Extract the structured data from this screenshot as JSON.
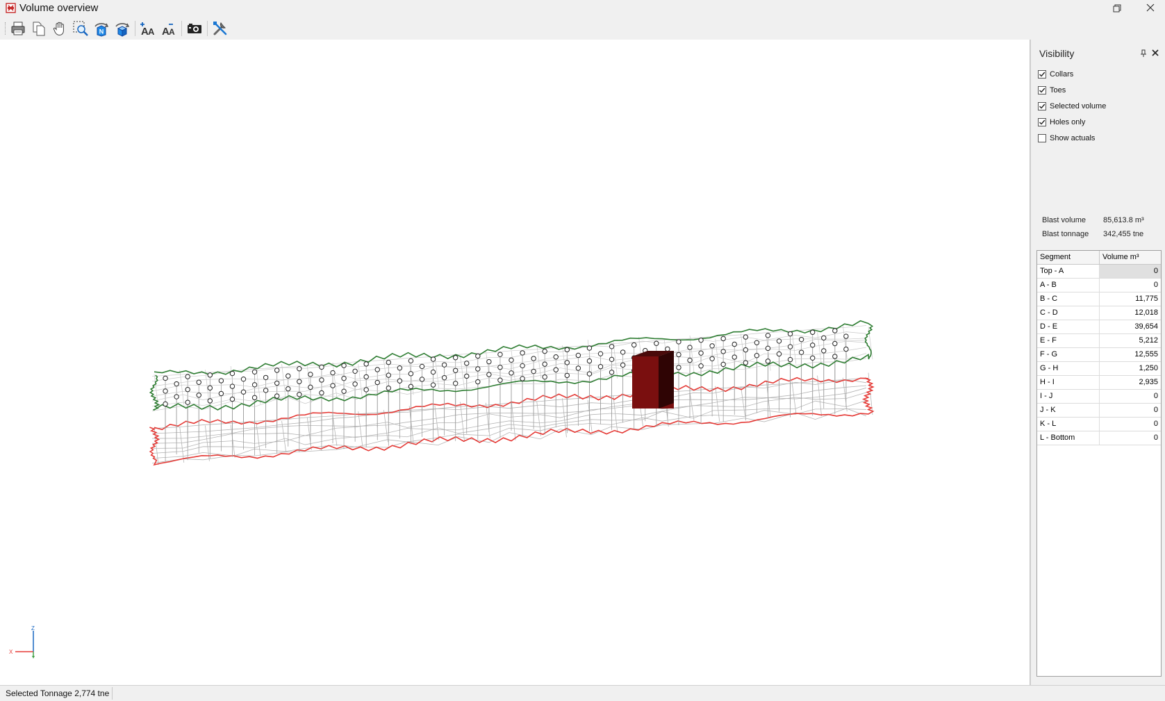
{
  "window": {
    "title": "Volume overview"
  },
  "toolbar": {
    "buttons": [
      {
        "name": "print",
        "icon": "printer-icon"
      },
      {
        "name": "copy",
        "icon": "copy-icon"
      },
      {
        "name": "pan",
        "icon": "hand-icon"
      },
      {
        "name": "zoom-window",
        "icon": "zoom-region-icon"
      },
      {
        "name": "rotate-north",
        "icon": "rotate-north-icon"
      },
      {
        "name": "rotate-3d",
        "icon": "rotate-3d-icon"
      },
      {
        "name": "increase-font",
        "icon": "font-increase-icon"
      },
      {
        "name": "decrease-font",
        "icon": "font-decrease-icon"
      },
      {
        "name": "snapshot",
        "icon": "camera-icon"
      },
      {
        "name": "settings",
        "icon": "tools-icon"
      }
    ]
  },
  "visibility": {
    "title": "Visibility",
    "options": [
      {
        "label": "Collars",
        "checked": true
      },
      {
        "label": "Toes",
        "checked": true
      },
      {
        "label": "Selected volume",
        "checked": true
      },
      {
        "label": "Holes only",
        "checked": true
      },
      {
        "label": "Show actuals",
        "checked": false
      }
    ]
  },
  "stats": {
    "blast_volume_label": "Blast volume",
    "blast_volume_value": "85,613.8 m³",
    "blast_tonnage_label": "Blast tonnage",
    "blast_tonnage_value": "342,455 tne"
  },
  "segments": {
    "headers": {
      "segment": "Segment",
      "volume": "Volume m³"
    },
    "rows": [
      {
        "segment": "Top - A",
        "volume": "0"
      },
      {
        "segment": "A - B",
        "volume": "0"
      },
      {
        "segment": "B - C",
        "volume": "11,775"
      },
      {
        "segment": "C - D",
        "volume": "12,018"
      },
      {
        "segment": "D - E",
        "volume": "39,654"
      },
      {
        "segment": "E - F",
        "volume": "5,212"
      },
      {
        "segment": "F - G",
        "volume": "12,555"
      },
      {
        "segment": "G - H",
        "volume": "1,250"
      },
      {
        "segment": "H - I",
        "volume": "2,935"
      },
      {
        "segment": "I - J",
        "volume": "0"
      },
      {
        "segment": "J - K",
        "volume": "0"
      },
      {
        "segment": "K - L",
        "volume": "0"
      },
      {
        "segment": "L - Bottom",
        "volume": "0"
      }
    ]
  },
  "viewport": {
    "axis_z": "Z",
    "axis_x": "X",
    "colors": {
      "top_outline": "#2e7d32",
      "bottom_outline": "#e53935",
      "mesh": "#b4b4b4",
      "selected_block": "#7a0f0f"
    }
  },
  "status": {
    "text": "Selected Tonnage 2,774 tne"
  }
}
